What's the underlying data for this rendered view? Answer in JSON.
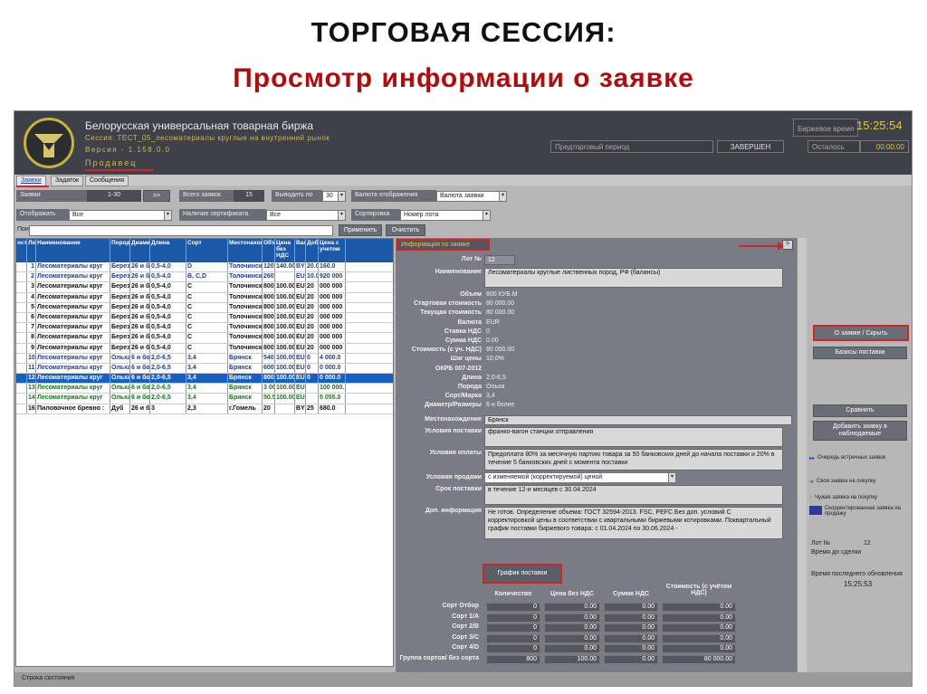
{
  "slide": {
    "title": "ТОРГОВАЯ СЕССИЯ:",
    "subtitle": "Просмотр информации о заявке"
  },
  "header": {
    "exchange": "Белорусская универсальная товарная биржа",
    "session": "Сессия: ТЕСТ_05_лесоматериалы круглые на внутренний рынок",
    "version": "Версия - 1.158.0.0",
    "role": "Продавец",
    "time_label": "Биржевое время",
    "time_value": "15:25:54",
    "period_label": "Предторговый период",
    "period_status": "ЗАВЕРШЕН",
    "remaining_label": "Осталось",
    "remaining_value": "00:00:00"
  },
  "tabs": [
    "Заявки",
    "Задаток",
    "Сообщения"
  ],
  "filters": {
    "orders_label": "Заявки",
    "range": "1-30",
    "next": ">>",
    "total_label": "Всего заявок",
    "total_value": "15",
    "per_page_label": "Выводить по",
    "per_page": "30",
    "currency_label": "Валюта отображения",
    "currency": "Валюта заявки",
    "show_label": "Отображать",
    "show_value": "Все",
    "cert_label": "Наличие сертификата",
    "cert_value": "Все",
    "sort_label": "Сортировка",
    "sort_value": "Номер лота",
    "search_label": "Пои",
    "apply": "Применить",
    "clear": "Очистить"
  },
  "grid": {
    "columns": [
      "ост",
      "Лот",
      "Наименование",
      "Порода",
      "Диаметр",
      "Длина",
      "Сорт",
      "Местонахождение",
      "Объем",
      "Цена без НДС",
      "Валюта",
      "Добавочный",
      "Цена с учетом"
    ],
    "rows": [
      {
        "c": [
          "",
          "1",
          "Лесоматериалы круг",
          "Берез",
          "26 и б",
          "0,5-4,0",
          "D",
          "Толочинский",
          "120",
          "140.00",
          "BYN",
          "20.0",
          "160.0"
        ],
        "k": "blue"
      },
      {
        "c": [
          "",
          "2",
          "Лесоматериалы круг",
          "Берез",
          "26 и б",
          "0,5-4,0",
          "B, C,D",
          "Толочинский",
          "260",
          "",
          "EUR",
          "10.0",
          "920 000"
        ],
        "k": "blue"
      },
      {
        "c": [
          "",
          "3",
          "Лесоматериалы круг",
          "Берез",
          "26 и б",
          "0,5-4,0",
          "C",
          "Толочинский",
          "800",
          "100.00",
          "EUR",
          "20",
          "000 000"
        ],
        "k": "black"
      },
      {
        "c": [
          "",
          "4",
          "Лесоматериалы круг",
          "Берез",
          "26 и б",
          "0,5-4,0",
          "C",
          "Толочинский",
          "800",
          "100.00",
          "EUR",
          "20",
          "000 000"
        ],
        "k": "black"
      },
      {
        "c": [
          "",
          "5",
          "Лесоматериалы круг",
          "Берез",
          "26 и б",
          "0,5-4,0",
          "C",
          "Толочинский",
          "800",
          "100.00",
          "EUR",
          "20",
          "000 000"
        ],
        "k": "black"
      },
      {
        "c": [
          "",
          "6",
          "Лесоматериалы круг",
          "Берез",
          "26 и б",
          "0,5-4,0",
          "C",
          "Толочинский",
          "800",
          "100.00",
          "EUR",
          "20",
          "000 000"
        ],
        "k": "black"
      },
      {
        "c": [
          "",
          "7",
          "Лесоматериалы круг",
          "Берез",
          "26 и б",
          "0,5-4,0",
          "C",
          "Толочинский",
          "800",
          "100.00",
          "EUR",
          "20",
          "000 000"
        ],
        "k": "black"
      },
      {
        "c": [
          "",
          "8",
          "Лесоматериалы круг",
          "Берез",
          "26 и б",
          "0,5-4,0",
          "C",
          "Толочинский",
          "800",
          "100.00",
          "EUR",
          "20",
          "000 000"
        ],
        "k": "black"
      },
      {
        "c": [
          "",
          "9",
          "Лесоматериалы круг",
          "Берез",
          "26 и б",
          "0,5-4,0",
          "C",
          "Толочинский",
          "800",
          "100.00",
          "EUR",
          "20",
          "000 000"
        ],
        "k": "black"
      },
      {
        "c": [
          "",
          "10",
          "Лесоматериалы круг",
          "Ольха",
          "6 и бо",
          "2,0-6,5",
          "3,4",
          "Брянск",
          "540",
          "100.00",
          "EUR",
          "0",
          "4 000.0"
        ],
        "k": "blue"
      },
      {
        "c": [
          "",
          "11",
          "Лесоматериалы круг",
          "Ольха",
          "6 и бо",
          "2,0-6,5",
          "3,4",
          "Брянск",
          "600",
          "100.00",
          "EUR",
          "0",
          "0 000.0"
        ],
        "k": "blue"
      },
      {
        "c": [
          "",
          "12",
          "Лесоматериалы круг",
          "Ольха",
          "6 и бо",
          "2,0-6,5",
          "3,4",
          "Брянск",
          "800",
          "100.00",
          "EUR",
          "0",
          "0 000.0"
        ],
        "k": "sel"
      },
      {
        "c": [
          "",
          "13",
          "Лесоматериалы круг",
          "Ольха",
          "6 и бо",
          "2,0-6,5",
          "3,4",
          "Брянск",
          "3 000",
          "100.00",
          "EUR",
          "",
          "100 000."
        ],
        "k": "green"
      },
      {
        "c": [
          "",
          "14",
          "Лесоматериалы круг",
          "Ольха",
          "6 и бо",
          "2,0-6,5",
          "3,4",
          "Брянск",
          "50.55",
          "100.00",
          "EUR",
          "",
          "5 055.0"
        ],
        "k": "green"
      },
      {
        "c": [
          "",
          "16",
          "Пиловочное бревно :",
          "Дуб",
          "26 и б",
          "3",
          "2,3",
          "г.Гомель",
          "20",
          "",
          "BYN",
          "25",
          "680.0"
        ],
        "k": "black"
      }
    ]
  },
  "info": {
    "title": "Информация по заявке",
    "lot_label": "Лот №",
    "lot": "12",
    "name_label": "Наименование",
    "name": "Лесоматериалы круглые лиственных пород, РФ (балансы)",
    "fields": [
      [
        "Объем",
        "800 КУБ.М"
      ],
      [
        "Стартовая стоимость",
        "80 000.00"
      ],
      [
        "Текущая стоимость",
        "80 000.00"
      ],
      [
        "Валюта",
        "EUR"
      ],
      [
        "Ставка НДС",
        "0"
      ],
      [
        "Сумма НДС",
        "0.00"
      ],
      [
        "Стоимость (с уч. НДС)",
        "80 000.00"
      ],
      [
        "Шаг цены",
        "10.0%"
      ],
      [
        "ОКРБ 007-2012",
        ""
      ],
      [
        "Длина",
        "2,0-6,5"
      ],
      [
        "Порода",
        "Ольха"
      ],
      [
        "Сорт/Марка",
        "3,4"
      ],
      [
        "Диаметр/Размеры",
        "6 и более"
      ]
    ],
    "location_label": "Местонахождение",
    "location": "Брянск",
    "delivery_label": "Условия поставки",
    "delivery": "франко-вагон станции отправления",
    "payment_label": "Условия оплаты",
    "payment": "Предоплата 80% за месячную партию товара за 50 банковских дней до начала поставки и 20% в течение 5 банковских дней с момента поставки",
    "sale_label": "Условия продажи",
    "sale": "с изменяемой (корректируемой) ценой",
    "term_label": "Срок поставки",
    "term": "в течение 12-и месяцев с 30.04.2024",
    "extra_label": "Доп. информация",
    "extra": "Не готов. Определение объема: ГОСТ 32594-2013. FSC, PEFC.Без доп. условий С корректировкой цены в соответствии с квартальными биржевыми котировками. Поквартальный график поставки биржевого товара: с 01.04.2024 по 30.06.2024 -",
    "schedule_btn": "График поставки",
    "sched_headers": [
      "Количество",
      "Цена без НДС",
      "Сумма НДС",
      "Стоимость (с учётом НДС)"
    ],
    "sched_rows": [
      [
        "Сорт Отбор",
        "0",
        "0.00",
        "0.00",
        "0.00"
      ],
      [
        "Сорт 1/A",
        "0",
        "0.00",
        "0.00",
        "0.00"
      ],
      [
        "Сорт 2/B",
        "0",
        "0.00",
        "0.00",
        "0.00"
      ],
      [
        "Сорт 3/C",
        "0",
        "0.00",
        "0.00",
        "0.00"
      ],
      [
        "Сорт 4/D",
        "0",
        "0.00",
        "0.00",
        "0.00"
      ],
      [
        "Группа сортов/ без сорта",
        "800",
        "100.00",
        "0.00",
        "80 000.00"
      ]
    ]
  },
  "right": {
    "toggle": "О заявке / Скрыть",
    "bases": "Базисы поставки",
    "compare": "Сравнить",
    "watch": "Добавить заявку в наблюдаемые",
    "legend": [
      "Очередь встречных заявок",
      "Своя заявка на покупку",
      "Чужая заявка на покупку",
      "Скорректированная заявка на продажу"
    ],
    "lot_label": "Лот №",
    "lot": "12",
    "until": "Время до сделки",
    "last_update_label": "Время последнего обновления",
    "last_update": "15:25:53"
  },
  "status": "Строка состояния",
  "colors": {
    "accent": "#d2222a",
    "header_bg": "#3f4149",
    "gold": "#d2b84a",
    "selected": "#1560c8"
  }
}
